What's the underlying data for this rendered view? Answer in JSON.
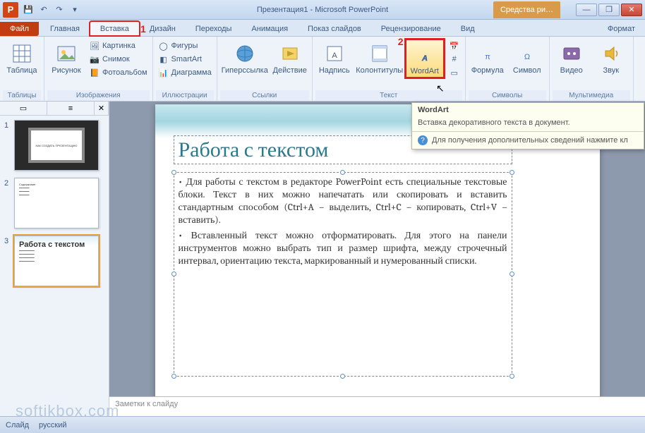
{
  "titlebar": {
    "app_letter": "P",
    "title": "Презентация1 - Microsoft PowerPoint",
    "context_tab": "Средства ри…",
    "qat": {
      "save": "💾",
      "undo": "↶",
      "redo": "↷",
      "down": "▾"
    },
    "win": {
      "min": "—",
      "max": "❐",
      "close": "✕"
    }
  },
  "tabs": {
    "file": "Файл",
    "home": "Главная",
    "insert": "Вставка",
    "design": "Дизайн",
    "transitions": "Переходы",
    "animations": "Анимация",
    "slideshow": "Показ слайдов",
    "review": "Рецензирование",
    "view": "Вид",
    "format": "Формат",
    "hl_num_1": "1"
  },
  "ribbon": {
    "tables": {
      "label": "Таблицы",
      "table": "Таблица"
    },
    "images": {
      "label": "Изображения",
      "picture": "Рисунок",
      "clipart": "Картинка",
      "screenshot": "Снимок",
      "album": "Фотоальбом"
    },
    "illustrations": {
      "label": "Иллюстрации",
      "shapes": "Фигуры",
      "smartart": "SmartArt",
      "chart": "Диаграмма"
    },
    "links": {
      "label": "Ссылки",
      "hyperlink": "Гиперссылка",
      "action": "Действие"
    },
    "text": {
      "label": "Текст",
      "textbox": "Надпись",
      "headerfooter": "Колонтитулы",
      "wordart": "WordArt",
      "hl_num_2": "2"
    },
    "symbols": {
      "label": "Символы",
      "equation": "Формула",
      "symbol": "Символ"
    },
    "media": {
      "label": "Мультимедиа",
      "video": "Видео",
      "audio": "Звук"
    }
  },
  "tooltip": {
    "title": "WordArt",
    "body": "Вставка декоративного текста в документ.",
    "footer": "Для получения дополнительных сведений нажмите кл"
  },
  "thumbs": {
    "n1": "1",
    "n2": "2",
    "n3": "3",
    "t1": "КАК СОЗДАТЬ ПРЕЗЕНТАЦИЮ",
    "t3_title": "Работа с текстом"
  },
  "slide": {
    "title": "Работа с текстом",
    "p1": "Для работы с текстом в редакторе PowerPoint есть специальные текстовые блоки. Текст в них можно напечатать или скопировать и вставить стандартным способом (Ctrl+A – выделить, Ctrl+C – копировать, Ctrl+V – вставить).",
    "p2": "Вставленный текст можно отформатировать. Для этого на панели инструментов можно выбрать тип и размер шрифта, между строчечный интервал, ориентацию текста, маркированный и нумерованный списки."
  },
  "notes": {
    "placeholder": "Заметки к слайду"
  },
  "status": {
    "lang": "русский"
  },
  "watermark": "softikbox.com"
}
